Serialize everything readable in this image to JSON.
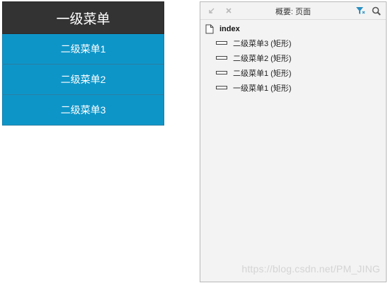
{
  "menu": {
    "header": "一级菜单",
    "items": [
      {
        "label": "二级菜单1"
      },
      {
        "label": "二级菜单2"
      },
      {
        "label": "二级菜单3"
      }
    ],
    "colors": {
      "header_bg": "#333333",
      "item_bg": "#0e95c8",
      "text": "#ffffff"
    }
  },
  "outline_panel": {
    "title": "概要: 页面",
    "toolbar_icons": [
      "collapse-icon",
      "close-icon",
      "filter-icon",
      "search-icon"
    ],
    "root": {
      "label": "index",
      "icon": "page-icon"
    },
    "children": [
      {
        "label": "二级菜单3 (矩形)",
        "icon": "rectangle-icon"
      },
      {
        "label": "二级菜单2 (矩形)",
        "icon": "rectangle-icon"
      },
      {
        "label": "二级菜单1 (矩形)",
        "icon": "rectangle-icon"
      },
      {
        "label": "一级菜单1 (矩形)",
        "icon": "rectangle-icon"
      }
    ],
    "watermark": "https://blog.csdn.net/PM_JING"
  }
}
